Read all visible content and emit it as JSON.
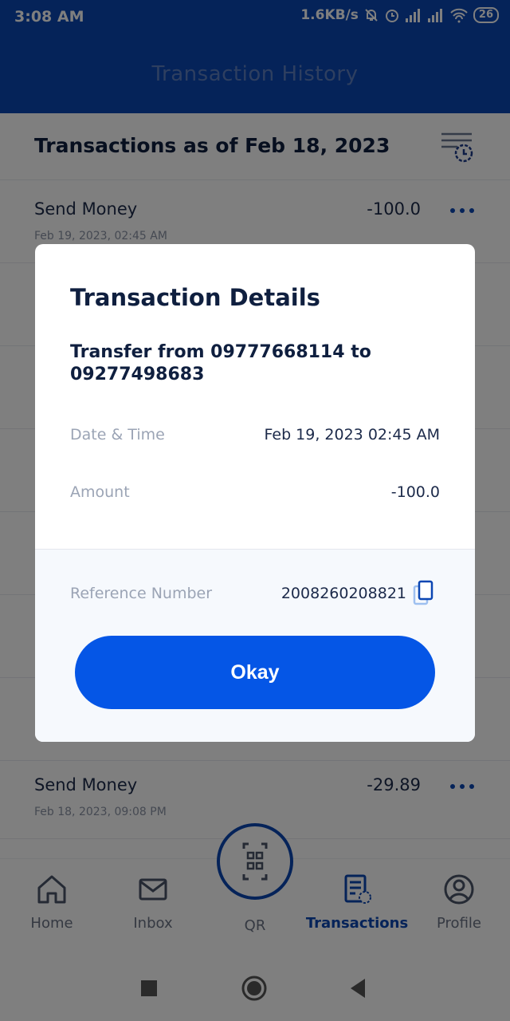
{
  "status_bar": {
    "time": "3:08 AM",
    "network_speed": "1.6KB/s",
    "battery": "26",
    "icons": [
      "bell-off-icon",
      "alarm-icon",
      "signal-icon",
      "signal-icon",
      "wifi-icon",
      "battery-icon"
    ]
  },
  "app_bar": {
    "title": "Transaction History"
  },
  "section": {
    "header": "Transactions as of Feb 18, 2023",
    "filter_icon": "history-filter-icon"
  },
  "transactions": [
    {
      "type": "Send Money",
      "date": "Feb 19, 2023, 02:45 AM",
      "amount": "-100.0"
    },
    {
      "type": "Send Money",
      "date": "Feb 18, 2023, 09:08 PM",
      "amount": "-29.89"
    }
  ],
  "dialog": {
    "title": "Transaction Details",
    "description": "Transfer from 09777668114 to 09277498683",
    "date_time_label": "Date & Time",
    "date_time_value": "Feb 19, 2023 02:45 AM",
    "amount_label": "Amount",
    "amount_value": "-100.0",
    "reference_label": "Reference Number",
    "reference_value": "2008260208821",
    "okay_label": "Okay"
  },
  "bottom_nav": [
    {
      "label": "Home",
      "icon": "home-icon"
    },
    {
      "label": "Inbox",
      "icon": "mail-icon"
    },
    {
      "label": "QR",
      "icon": "qr-scan-icon"
    },
    {
      "label": "Transactions",
      "icon": "transactions-icon",
      "active": true
    },
    {
      "label": "Profile",
      "icon": "profile-icon"
    }
  ],
  "colors": {
    "brand": "#0b46b3",
    "button": "#0556e6",
    "text_dark": "#0f1f3f"
  }
}
